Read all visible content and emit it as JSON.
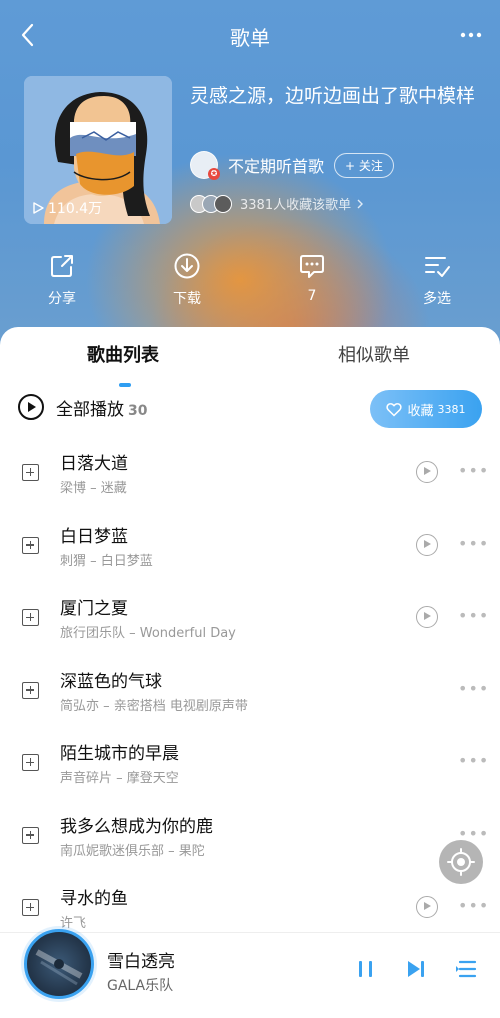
{
  "header": {
    "title": "歌单"
  },
  "playlist": {
    "play_count": "110.4万",
    "title": "灵感之源，边听边画出了歌中模样",
    "creator_name": "不定期听首歌",
    "follow_label": "+ 关注",
    "collectors_text": "3381人收藏该歌单"
  },
  "actions": [
    {
      "label": "分享",
      "icon": "share-icon"
    },
    {
      "label": "下载",
      "icon": "download-icon"
    },
    {
      "label": "7",
      "icon": "comment-icon"
    },
    {
      "label": "多选",
      "icon": "multi-select-icon"
    }
  ],
  "tabs": [
    {
      "label": "歌曲列表",
      "active": true
    },
    {
      "label": "相似歌单",
      "active": false
    }
  ],
  "play_all": {
    "label": "全部播放",
    "count": "30"
  },
  "collect_button": {
    "label": "收藏",
    "count": "3381"
  },
  "songs": [
    {
      "title": "日落大道",
      "subtitle": "梁博 – 迷藏",
      "has_mv": true
    },
    {
      "title": "白日梦蓝",
      "subtitle": "刺猬 – 白日梦蓝",
      "has_mv": true
    },
    {
      "title": "厦门之夏",
      "subtitle": "旅行团乐队 – Wonderful Day",
      "has_mv": true
    },
    {
      "title": "深蓝色的气球",
      "subtitle": "简弘亦 – 亲密搭档 电视剧原声带",
      "has_mv": false
    },
    {
      "title": "陌生城市的早晨",
      "subtitle": "声音碎片 – 摩登天空",
      "has_mv": false
    },
    {
      "title": "我多么想成为你的鹿",
      "subtitle": "南瓜妮歌迷俱乐部 – 果陀",
      "has_mv": false
    },
    {
      "title": "寻水的鱼",
      "subtitle": "许飞",
      "has_mv": true
    }
  ],
  "now_playing": {
    "title": "雪白透亮",
    "artist": "GALA乐队"
  },
  "colors": {
    "accent": "#3aa2f0",
    "hero_blue": "#5f9bd6",
    "hero_orange": "#e8963c"
  }
}
